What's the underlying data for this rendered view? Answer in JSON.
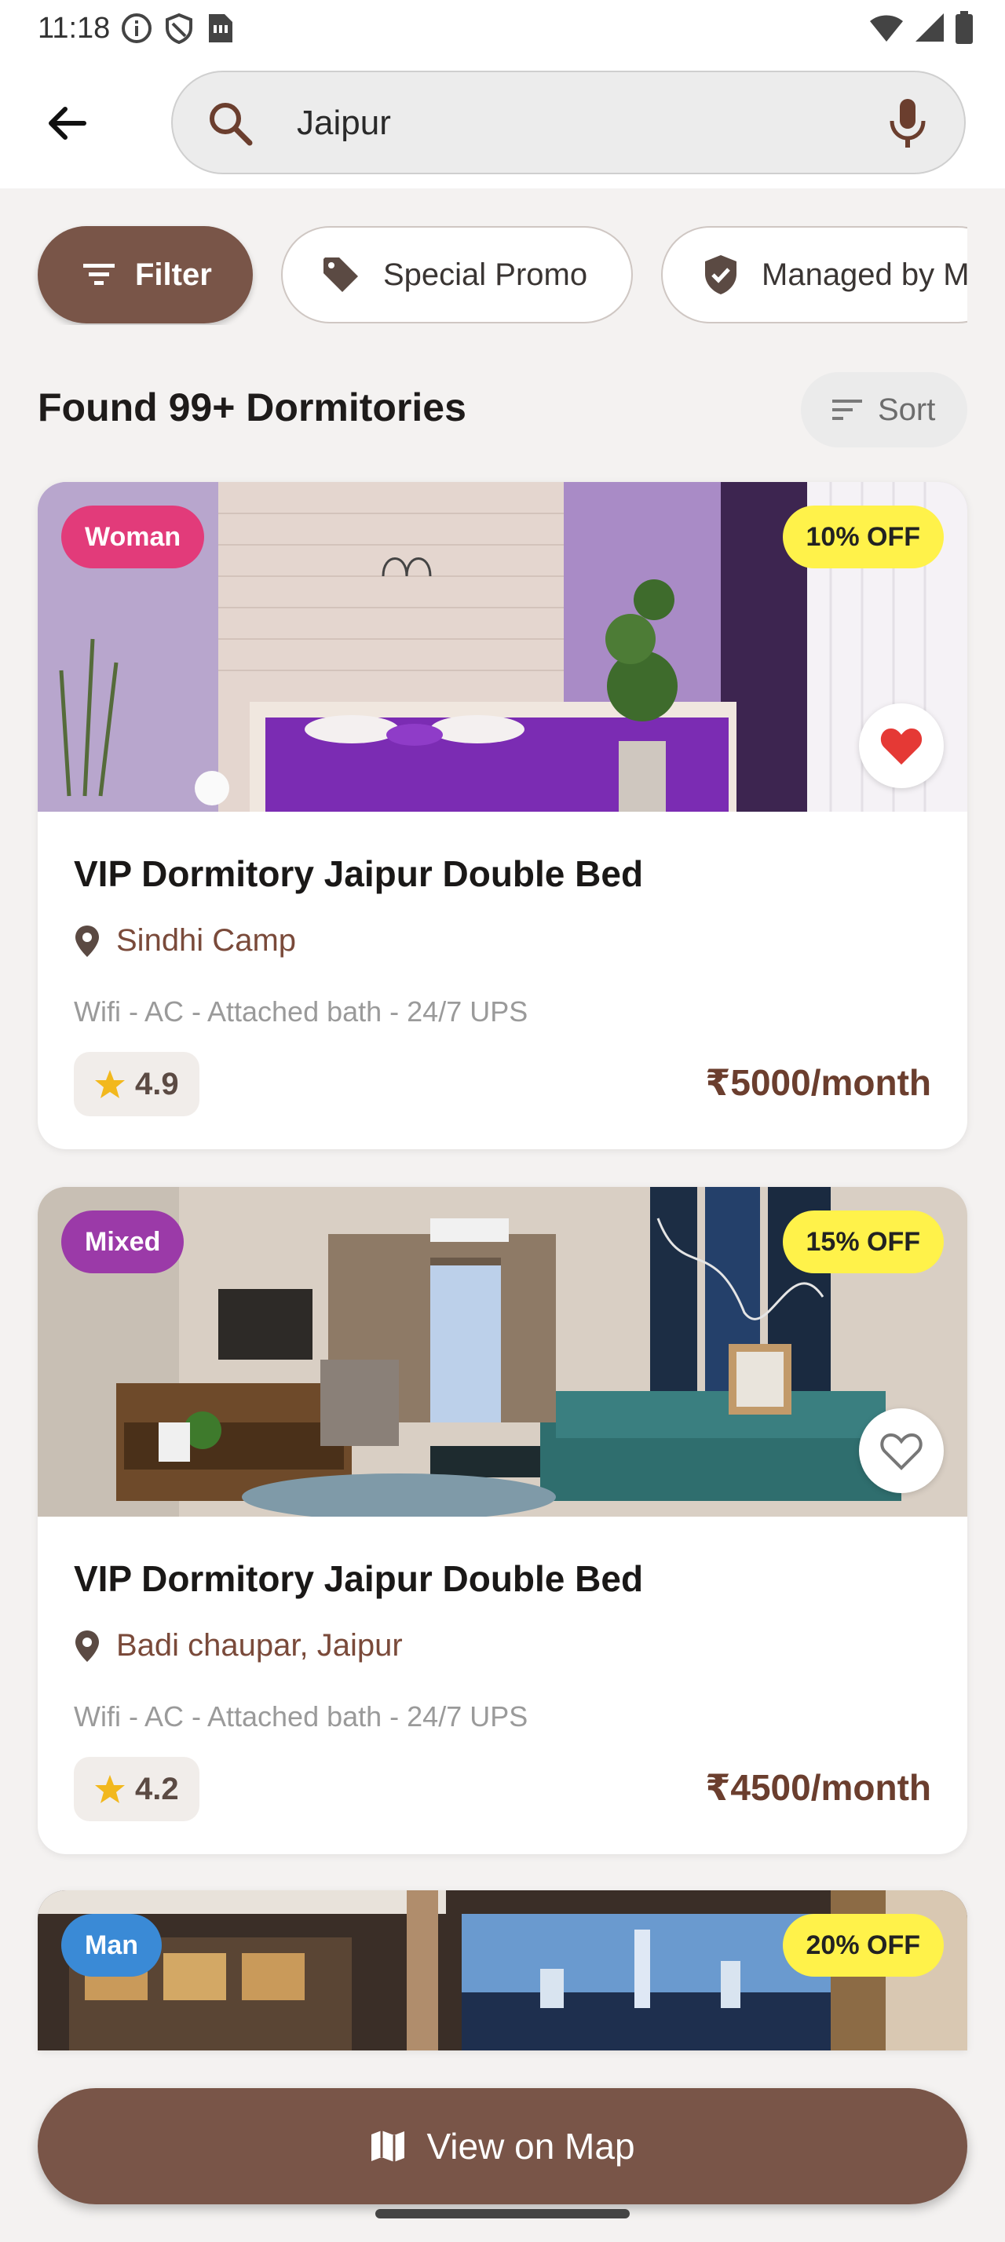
{
  "status": {
    "time": "11:18"
  },
  "search": {
    "query": "Jaipur"
  },
  "chips": [
    {
      "label": "Filter"
    },
    {
      "label": "Special Promo"
    },
    {
      "label": "Managed by M"
    }
  ],
  "results": {
    "title": "Found 99+ Dormitories",
    "sort_label": "Sort"
  },
  "cards": [
    {
      "tag": "Woman",
      "tag_color": "#e23b7a",
      "discount": "10% OFF",
      "favorited": true,
      "title": "VIP Dormitory Jaipur Double Bed",
      "location": "Sindhi Camp",
      "amenities": "Wifi - AC - Attached bath - 24/7 UPS",
      "rating": "4.9",
      "price": "₹5000/month"
    },
    {
      "tag": "Mixed",
      "tag_color": "#9b3aa8",
      "discount": "15% OFF",
      "favorited": false,
      "title": "VIP Dormitory Jaipur Double Bed",
      "location": "Badi chaupar, Jaipur",
      "amenities": "Wifi - AC - Attached bath - 24/7 UPS",
      "rating": "4.2",
      "price": "₹4500/month"
    },
    {
      "tag": "Man",
      "tag_color": "#3a8ad6",
      "discount": "20% OFF"
    }
  ],
  "map_button": {
    "label": "View on Map"
  },
  "colors": {
    "primary": "#795548",
    "price": "#6b3e2e",
    "discount_bg": "#fff24a"
  }
}
